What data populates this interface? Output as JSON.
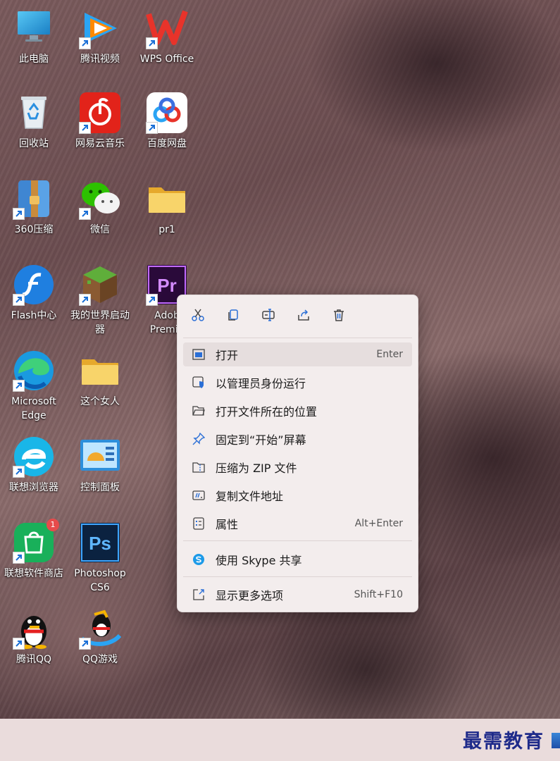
{
  "desktop": {
    "icons": [
      {
        "label": "此电脑"
      },
      {
        "label": "腾讯视频"
      },
      {
        "label": "WPS Office"
      },
      {
        "label": "回收站"
      },
      {
        "label": "网易云音乐"
      },
      {
        "label": "百度网盘"
      },
      {
        "label": "360压缩"
      },
      {
        "label": "微信"
      },
      {
        "label": "pr1"
      },
      {
        "label": "Flash中心"
      },
      {
        "label": "我的世界启动\n器"
      },
      {
        "label": "Adob\nPremie"
      },
      {
        "label": "Microsoft\nEdge"
      },
      {
        "label": "这个女人"
      },
      {
        "label": "联想浏览器"
      },
      {
        "label": "控制面板"
      },
      {
        "label": "联想软件商店",
        "badge": "1"
      },
      {
        "label": "Photoshop\nCS6"
      },
      {
        "label": "腾讯QQ"
      },
      {
        "label": "QQ游戏"
      }
    ]
  },
  "context_menu": {
    "toolbar": [
      "cut-icon",
      "copy-icon",
      "rename-icon",
      "share-icon",
      "delete-icon"
    ],
    "items": [
      {
        "label": "打开",
        "shortcut": "Enter"
      },
      {
        "label": "以管理员身份运行",
        "shortcut": ""
      },
      {
        "label": "打开文件所在的位置",
        "shortcut": ""
      },
      {
        "label": "固定到“开始”屏幕",
        "shortcut": ""
      },
      {
        "label": "压缩为 ZIP 文件",
        "shortcut": ""
      },
      {
        "label": "复制文件地址",
        "shortcut": ""
      },
      {
        "label": "属性",
        "shortcut": "Alt+Enter"
      },
      {
        "label": "使用 Skype 共享",
        "shortcut": ""
      },
      {
        "label": "显示更多选项",
        "shortcut": "Shift+F10"
      }
    ]
  },
  "taskbar": {
    "watermark": "最需教育"
  },
  "colors": {
    "accent": "#2b6fd6",
    "menu_bg": "#f3eded",
    "taskbar_bg": "#eadcdc"
  }
}
